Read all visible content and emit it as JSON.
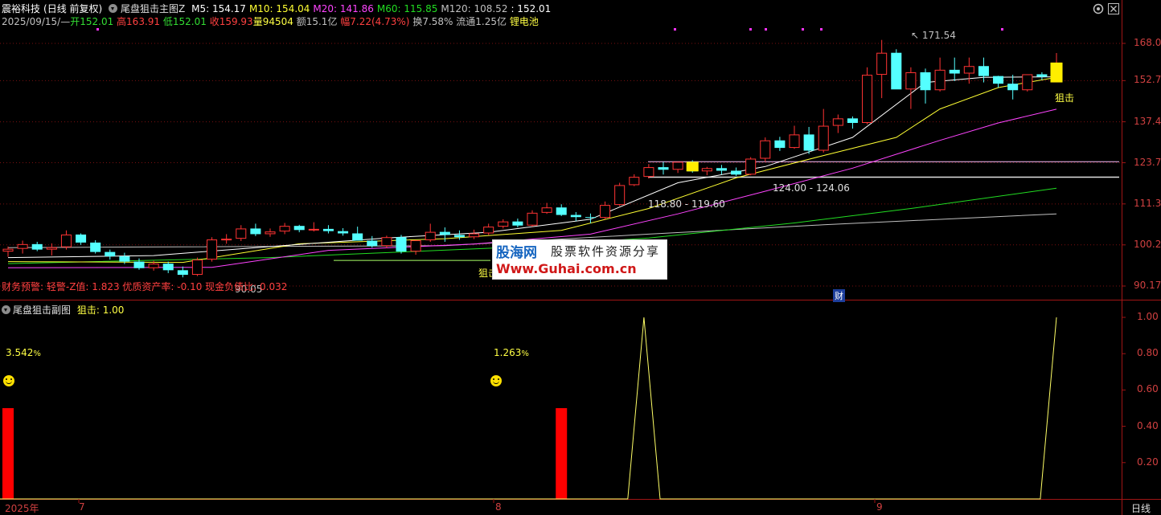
{
  "header": {
    "stock_name": "震裕科技",
    "period_mode": "(日线 前复权)",
    "indicator_name": "尾盘狙击主图Z",
    "ma": [
      {
        "label": "M5: 154.17",
        "color": "#ffffff"
      },
      {
        "label": "M10: 154.04",
        "color": "#ffff33"
      },
      {
        "label": "M20: 141.86",
        "color": "#ff44ff"
      },
      {
        "label": "M60: 115.85",
        "color": "#22dd22"
      },
      {
        "label": "M120: 108.52",
        "color": "#c0c0c0"
      },
      {
        "label": ": 152.01",
        "color": "#ffffff"
      }
    ],
    "date": "2025/09/15/—",
    "open": "开152.01",
    "high": "高163.91",
    "low": "低152.01",
    "close": "收159.93",
    "volume": "量94504",
    "amount": "额15.1亿",
    "change": "幅7.22(4.73%)",
    "turnover": "换7.58%",
    "float": "流通1.25亿",
    "concept": "锂电池"
  },
  "colors": {
    "up": "#ff3333",
    "down": "#54ffff",
    "ma5": "#ffffff",
    "ma10": "#ffff33",
    "ma20": "#ff44ff",
    "ma60": "#22dd22",
    "ma120": "#c0c0c0",
    "axis": "#c02020",
    "bar": "#ff0000",
    "signal_line": "#ffff66"
  },
  "main_chart": {
    "y_ticks": [
      "168.0",
      "152.7",
      "137.4",
      "123.7",
      "111.3",
      "100.2",
      "90.17"
    ],
    "high_marker": "171.54",
    "low_marker": "90.05",
    "range_label_1": "124.00 - 124.06",
    "range_label_2": "118.80 - 119.60",
    "signal_label_1": "狙击",
    "signal_label_2": "狙击",
    "finance_marker": "财",
    "footer_text": "财务预警: 轻警-Z值: 1.823 优质资产率: -0.10 现金负债比: 0.032"
  },
  "watermark": {
    "brand": "股海网",
    "slogan": "股票软件资源分享",
    "url": "Www.Guhai.com.cn"
  },
  "sub_chart": {
    "title": "尾盘狙击副图",
    "series_label": "狙击: 1.00",
    "y_ticks": [
      "1.00",
      "0.80",
      "0.60",
      "0.40",
      "0.20"
    ],
    "pct_1": "3.542",
    "pct_2": "1.263",
    "pct_unit": "%"
  },
  "x_axis": {
    "labels": [
      "2025年",
      "7",
      "8",
      "9"
    ],
    "period_button": "日线"
  },
  "chart_data": [
    {
      "type": "candlestick",
      "title": "尾盘狙击主图Z",
      "ylim": [
        88,
        172
      ],
      "y_scale": "log",
      "x": [
        "2025-06-05",
        "2025-06-06",
        "2025-06-09",
        "2025-06-10",
        "2025-06-11",
        "2025-06-12",
        "2025-06-13",
        "2025-06-16",
        "2025-06-17",
        "2025-06-18",
        "2025-06-19",
        "2025-06-20",
        "2025-06-23",
        "2025-06-24",
        "2025-06-25",
        "2025-06-26",
        "2025-06-27",
        "2025-06-30",
        "2025-07-01",
        "2025-07-02",
        "2025-07-03",
        "2025-07-04",
        "2025-07-07",
        "2025-07-08",
        "2025-07-09",
        "2025-07-10",
        "2025-07-11",
        "2025-07-14",
        "2025-07-15",
        "2025-07-16",
        "2025-07-17",
        "2025-07-18",
        "2025-07-21",
        "2025-07-22",
        "2025-07-23",
        "2025-07-24",
        "2025-07-25",
        "2025-07-28",
        "2025-07-29",
        "2025-07-30",
        "2025-07-31",
        "2025-08-01",
        "2025-08-04",
        "2025-08-05",
        "2025-08-06",
        "2025-08-07",
        "2025-08-08",
        "2025-08-11",
        "2025-08-12",
        "2025-08-13",
        "2025-08-14",
        "2025-08-15",
        "2025-08-18",
        "2025-08-19",
        "2025-08-20",
        "2025-08-21",
        "2025-08-22",
        "2025-08-25",
        "2025-08-26",
        "2025-08-27",
        "2025-08-28",
        "2025-08-29",
        "2025-09-01",
        "2025-09-02",
        "2025-09-03",
        "2025-09-04",
        "2025-09-05",
        "2025-09-08",
        "2025-09-09",
        "2025-09-10",
        "2025-09-11",
        "2025-09-12",
        "2025-09-15"
      ],
      "ohlc": [
        [
          98.5,
          99.8,
          97.2,
          99.2
        ],
        [
          99.2,
          101.3,
          98.0,
          100.4
        ],
        [
          100.4,
          101.0,
          98.6,
          99.0
        ],
        [
          99.0,
          100.6,
          97.5,
          99.6
        ],
        [
          99.6,
          104.0,
          99.0,
          102.9
        ],
        [
          102.9,
          103.2,
          100.2,
          100.8
        ],
        [
          100.8,
          101.4,
          98.0,
          98.4
        ],
        [
          98.4,
          99.0,
          96.5,
          97.3
        ],
        [
          97.3,
          98.2,
          95.4,
          96.0
        ],
        [
          96.0,
          96.8,
          94.0,
          94.4
        ],
        [
          94.4,
          96.2,
          93.8,
          95.5
        ],
        [
          95.5,
          96.0,
          93.2,
          93.9
        ],
        [
          93.9,
          94.8,
          92.2,
          92.8
        ],
        [
          92.8,
          97.0,
          92.5,
          96.5
        ],
        [
          96.5,
          102.2,
          96.0,
          101.6
        ],
        [
          101.6,
          103.0,
          100.5,
          101.8
        ],
        [
          101.8,
          105.4,
          101.2,
          104.5
        ],
        [
          104.5,
          105.8,
          102.5,
          103.0
        ],
        [
          103.0,
          104.5,
          102.3,
          103.7
        ],
        [
          103.7,
          106.0,
          103.0,
          105.2
        ],
        [
          105.2,
          105.5,
          103.5,
          104.1
        ],
        [
          104.1,
          106.2,
          103.7,
          104.4
        ],
        [
          104.4,
          105.4,
          103.2,
          103.8
        ],
        [
          103.8,
          104.6,
          102.6,
          103.2
        ],
        [
          103.2,
          105.0,
          102.0,
          101.3
        ],
        [
          101.3,
          102.5,
          99.5,
          99.9
        ],
        [
          99.9,
          102.6,
          99.4,
          102.2
        ],
        [
          102.2,
          102.8,
          98.0,
          98.5
        ],
        [
          98.5,
          99.5,
          97.7,
          101.4
        ],
        [
          101.4,
          105.8,
          101.0,
          103.6
        ],
        [
          103.6,
          104.8,
          101.0,
          102.8
        ],
        [
          102.8,
          104.0,
          101.5,
          102.2
        ],
        [
          102.2,
          104.2,
          101.7,
          103.2
        ],
        [
          103.2,
          105.8,
          102.8,
          105.0
        ],
        [
          105.0,
          107.0,
          104.5,
          106.4
        ],
        [
          106.4,
          107.2,
          104.8,
          105.3
        ],
        [
          105.3,
          109.5,
          105.0,
          108.8
        ],
        [
          108.8,
          111.6,
          108.5,
          110.3
        ],
        [
          110.3,
          111.2,
          107.9,
          108.2
        ],
        [
          108.2,
          109.0,
          106.5,
          107.6
        ],
        [
          107.6,
          108.6,
          105.9,
          107.4
        ],
        [
          107.4,
          112.0,
          107.0,
          111.0
        ],
        [
          111.0,
          117.5,
          110.7,
          116.8
        ],
        [
          116.8,
          120.1,
          116.5,
          119.3
        ],
        [
          119.3,
          123.3,
          118.8,
          122.3
        ],
        [
          122.3,
          124.0,
          120.0,
          121.5
        ],
        [
          121.5,
          124.0,
          120.5,
          124.0
        ],
        [
          124.0,
          124.5,
          120.6,
          121.0
        ],
        [
          121.0,
          122.4,
          119.8,
          122.0
        ],
        [
          122.0,
          123.0,
          120.0,
          121.2
        ],
        [
          121.2,
          122.2,
          119.6,
          120.0
        ],
        [
          120.0,
          125.5,
          119.8,
          125.0
        ],
        [
          125.0,
          132.0,
          124.0,
          131.0
        ],
        [
          131.0,
          132.2,
          127.5,
          128.5
        ],
        [
          128.5,
          136.0,
          128.2,
          133.0
        ],
        [
          133.0,
          135.6,
          126.5,
          127.6
        ],
        [
          127.6,
          142.0,
          127.0,
          136.0
        ],
        [
          136.0,
          140.0,
          133.5,
          138.6
        ],
        [
          138.6,
          139.3,
          135.0,
          137.0
        ],
        [
          137.0,
          158.0,
          136.5,
          155.0
        ],
        [
          155.0,
          169.5,
          146.0,
          164.0
        ],
        [
          164.0,
          165.5,
          149.5,
          149.3
        ],
        [
          149.3,
          158.0,
          142.0,
          156.0
        ],
        [
          156.0,
          157.5,
          144.0,
          149.0
        ],
        [
          149.0,
          162.0,
          148.5,
          157.0
        ],
        [
          157.0,
          162.0,
          152.5,
          155.5
        ],
        [
          155.5,
          162.0,
          151.5,
          158.5
        ],
        [
          158.5,
          162.0,
          152.0,
          154.5
        ],
        [
          154.5,
          154.6,
          150.0,
          151.5
        ],
        [
          151.5,
          155.0,
          145.5,
          149.0
        ],
        [
          149.0,
          155.0,
          148.5,
          155.2
        ],
        [
          155.2,
          156.0,
          153.0,
          154.2
        ],
        [
          152.01,
          163.91,
          152.01,
          159.93
        ]
      ],
      "ma": {
        "M5": [
          [
            0,
            97.0
          ],
          [
            10,
            97.5
          ],
          [
            17,
            99.5
          ],
          [
            26,
            102.0
          ],
          [
            33,
            103.5
          ],
          [
            40,
            107.0
          ],
          [
            46,
            117.5
          ],
          [
            52,
            122.5
          ],
          [
            58,
            132.0
          ],
          [
            63,
            152.0
          ],
          [
            67,
            154.0
          ],
          [
            72,
            154.2
          ]
        ],
        "M10": [
          [
            0,
            96.0
          ],
          [
            12,
            95.8
          ],
          [
            20,
            100.5
          ],
          [
            30,
            101.8
          ],
          [
            38,
            104.0
          ],
          [
            44,
            110.0
          ],
          [
            50,
            119.0
          ],
          [
            56,
            126.0
          ],
          [
            61,
            132.0
          ],
          [
            64,
            142.0
          ],
          [
            68,
            150.0
          ],
          [
            72,
            154.0
          ]
        ],
        "M20": [
          [
            0,
            94.5
          ],
          [
            14,
            94.6
          ],
          [
            22,
            98.8
          ],
          [
            32,
            100.4
          ],
          [
            40,
            103.0
          ],
          [
            46,
            108.5
          ],
          [
            52,
            115.0
          ],
          [
            58,
            122.0
          ],
          [
            64,
            131.0
          ],
          [
            68,
            137.0
          ],
          [
            72,
            141.9
          ]
        ],
        "M60": [
          [
            0,
            95.5
          ],
          [
            18,
            97.0
          ],
          [
            34,
            99.5
          ],
          [
            44,
            102.0
          ],
          [
            54,
            106.0
          ],
          [
            62,
            110.0
          ],
          [
            72,
            115.9
          ]
        ],
        "M120": [
          [
            0,
            99.5
          ],
          [
            30,
            100.0
          ],
          [
            44,
            103.0
          ],
          [
            56,
            105.5
          ],
          [
            72,
            108.5
          ]
        ]
      }
    },
    {
      "type": "line",
      "title": "尾盘狙击副图",
      "ylim": [
        0,
        1.0
      ],
      "x": [
        "2025-06-05",
        "2025-07-25",
        "2025-07-28",
        "2025-07-29",
        "2025-09-12",
        "2025-09-15"
      ],
      "series": [
        {
          "name": "狙击",
          "values": [
            0,
            0,
            1.0,
            0,
            0,
            1.0
          ]
        }
      ],
      "bars": [
        {
          "x": "2025-06-05",
          "value": 0.5
        },
        {
          "x": "2025-07-29",
          "value": 0.5
        }
      ]
    }
  ]
}
